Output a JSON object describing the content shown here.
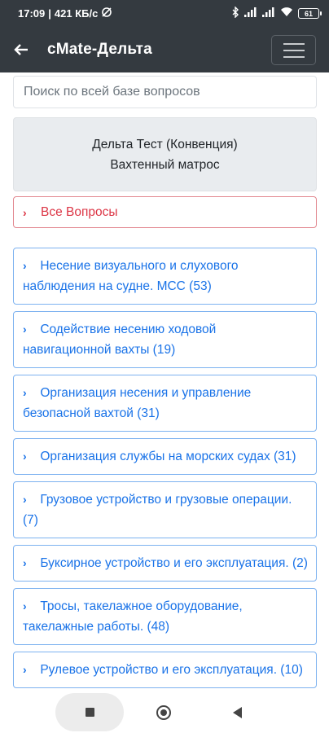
{
  "status_bar": {
    "time": "17:09",
    "network_speed": "421 КБ/с",
    "battery": "61"
  },
  "app_bar": {
    "title": "cMate-Дельта"
  },
  "search": {
    "placeholder": "Поиск по всей базе вопросов"
  },
  "info_card": {
    "line1": "Дельта Тест (Конвенция)",
    "line2": "Вахтенный матрос"
  },
  "all_questions_label": "Все Вопросы",
  "topics": [
    {
      "label": "Несение визуального и слухового наблюдения на судне. МСС (53)"
    },
    {
      "label": "Содействие несению ходовой навигационной вахты (19)"
    },
    {
      "label": "Организация несения и управление безопасной вахтой (31)"
    },
    {
      "label": "Организация службы на морских судах (31)"
    },
    {
      "label": "Грузовое устройство и грузовые операции. (7)"
    },
    {
      "label": "Буксирное устройство и его эксплуатация. (2)"
    },
    {
      "label": "Тросы, такелажное оборудование, такелажные работы. (48)"
    },
    {
      "label": "Рулевое устройство и его эксплуатация. (10)"
    }
  ],
  "colors": {
    "toolbar": "#343a40",
    "link": "#1a73e8",
    "danger": "#dc3545",
    "card": "#e9ecef"
  }
}
